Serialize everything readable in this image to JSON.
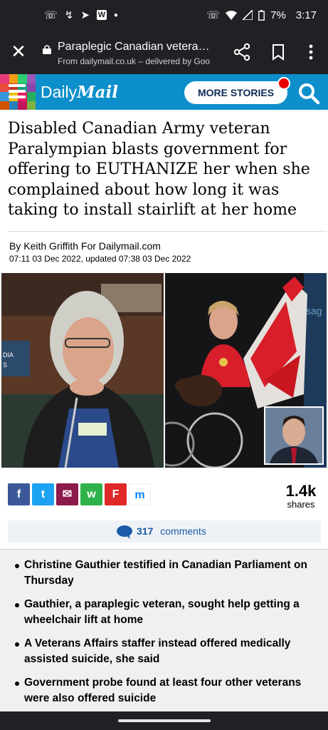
{
  "status_bar": {
    "time": "3:17",
    "battery": "7%",
    "left_icons": [
      "wifi-calling-icon",
      "missed-call-icon",
      "telegram-icon",
      "word-icon",
      "dot-icon"
    ],
    "right_icons": [
      "wifi-calling-icon",
      "wifi-icon",
      "signal-icon",
      "battery-icon"
    ]
  },
  "browser": {
    "page_title": "Paraplegic Canadian vetera…",
    "origin": "From dailymail.co.uk – delivered by Goo",
    "close_icon": "close-icon",
    "share_icon": "share-icon",
    "bookmark_icon": "bookmark-icon",
    "menu_icon": "more-vert-icon"
  },
  "site_header": {
    "logo_daily": "Daily",
    "logo_mail": "Mail",
    "more_stories": "MORE STORIES",
    "brand_color": "#0d8fcb"
  },
  "article": {
    "headline": "Disabled Canadian Army veteran Paralympian blasts government for offering to EUTHANIZE her when she complained about how long it was taking to install stairlift at her home",
    "byline": "By Keith Griffith For Dailymail.com",
    "dates": "07:11 03 Dec 2022, updated 07:38 03 Dec 2022",
    "photo_left_caption": "DIA S",
    "photo_right_text": "sag"
  },
  "share": {
    "buttons": [
      {
        "name": "facebook",
        "glyph": "f",
        "color": "#3b5998"
      },
      {
        "name": "twitter",
        "glyph": "t",
        "color": "#1da1f2"
      },
      {
        "name": "email",
        "glyph": "✉",
        "color": "#8c1a4b"
      },
      {
        "name": "whatsapp",
        "glyph": "w",
        "color": "#2fb24a"
      },
      {
        "name": "flipboard",
        "glyph": "F",
        "color": "#e12828"
      },
      {
        "name": "messenger",
        "glyph": "m",
        "color": "#ffffff"
      }
    ],
    "count": "1.4k",
    "count_label": "shares"
  },
  "comments": {
    "count": "317",
    "label": "comments"
  },
  "bullets": [
    "Christine Gauthier testified in Canadian Parliament on Thursday",
    "Gauthier, a paraplegic veteran, sought help getting a wheelchair lift at home",
    "A Veterans Affairs staffer instead offered medically assisted suicide, she said",
    "Government probe found at least four other veterans were also offered suicide"
  ]
}
